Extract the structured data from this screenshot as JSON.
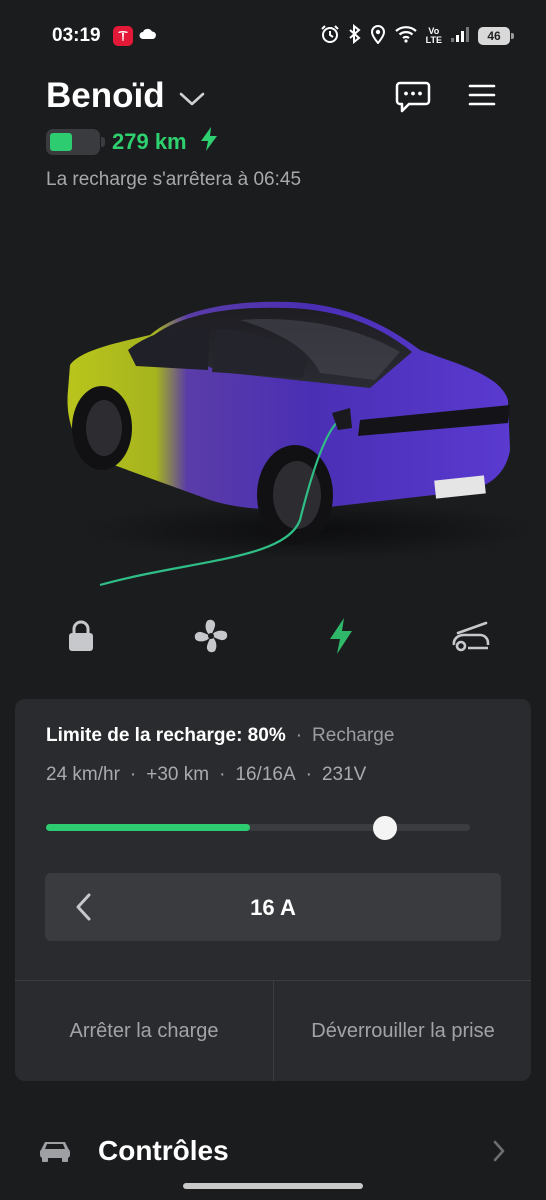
{
  "status_bar": {
    "time": "03:19",
    "volte_top": "Vo",
    "volte_bottom": "LTE",
    "battery_level": "46",
    "icons": [
      "tesla-app-icon",
      "cloud-icon",
      "alarm-icon",
      "bluetooth-icon",
      "location-icon",
      "wifi-icon",
      "signal-icon"
    ]
  },
  "header": {
    "vehicle_name": "Benoïd",
    "range": "279 km",
    "battery_fraction": 0.48,
    "charge_stop_text": "La recharge s'arrêtera à 06:45"
  },
  "quick_actions": [
    "lock-icon",
    "fan-icon",
    "charging-bolt-icon",
    "frunk-icon"
  ],
  "charge_panel": {
    "limit_label": "Limite de la recharge: 80%",
    "separator": "·",
    "status": "Recharge",
    "rate": "24 km/hr",
    "added": "+30 km",
    "current": "16/16A",
    "voltage": "231V",
    "current_charge_fraction": 0.48,
    "limit_fraction": 0.8,
    "amperage": "16 A",
    "stop_button": "Arrêter la charge",
    "unlock_button": "Déverrouiller la prise"
  },
  "controls": {
    "label": "Contrôles"
  },
  "colors": {
    "background": "#1b1c1e",
    "card": "#2a2b2e",
    "accent_green": "#2ecc71",
    "car_purple": "#4b2fb8",
    "car_yellow": "#b8c51a"
  }
}
